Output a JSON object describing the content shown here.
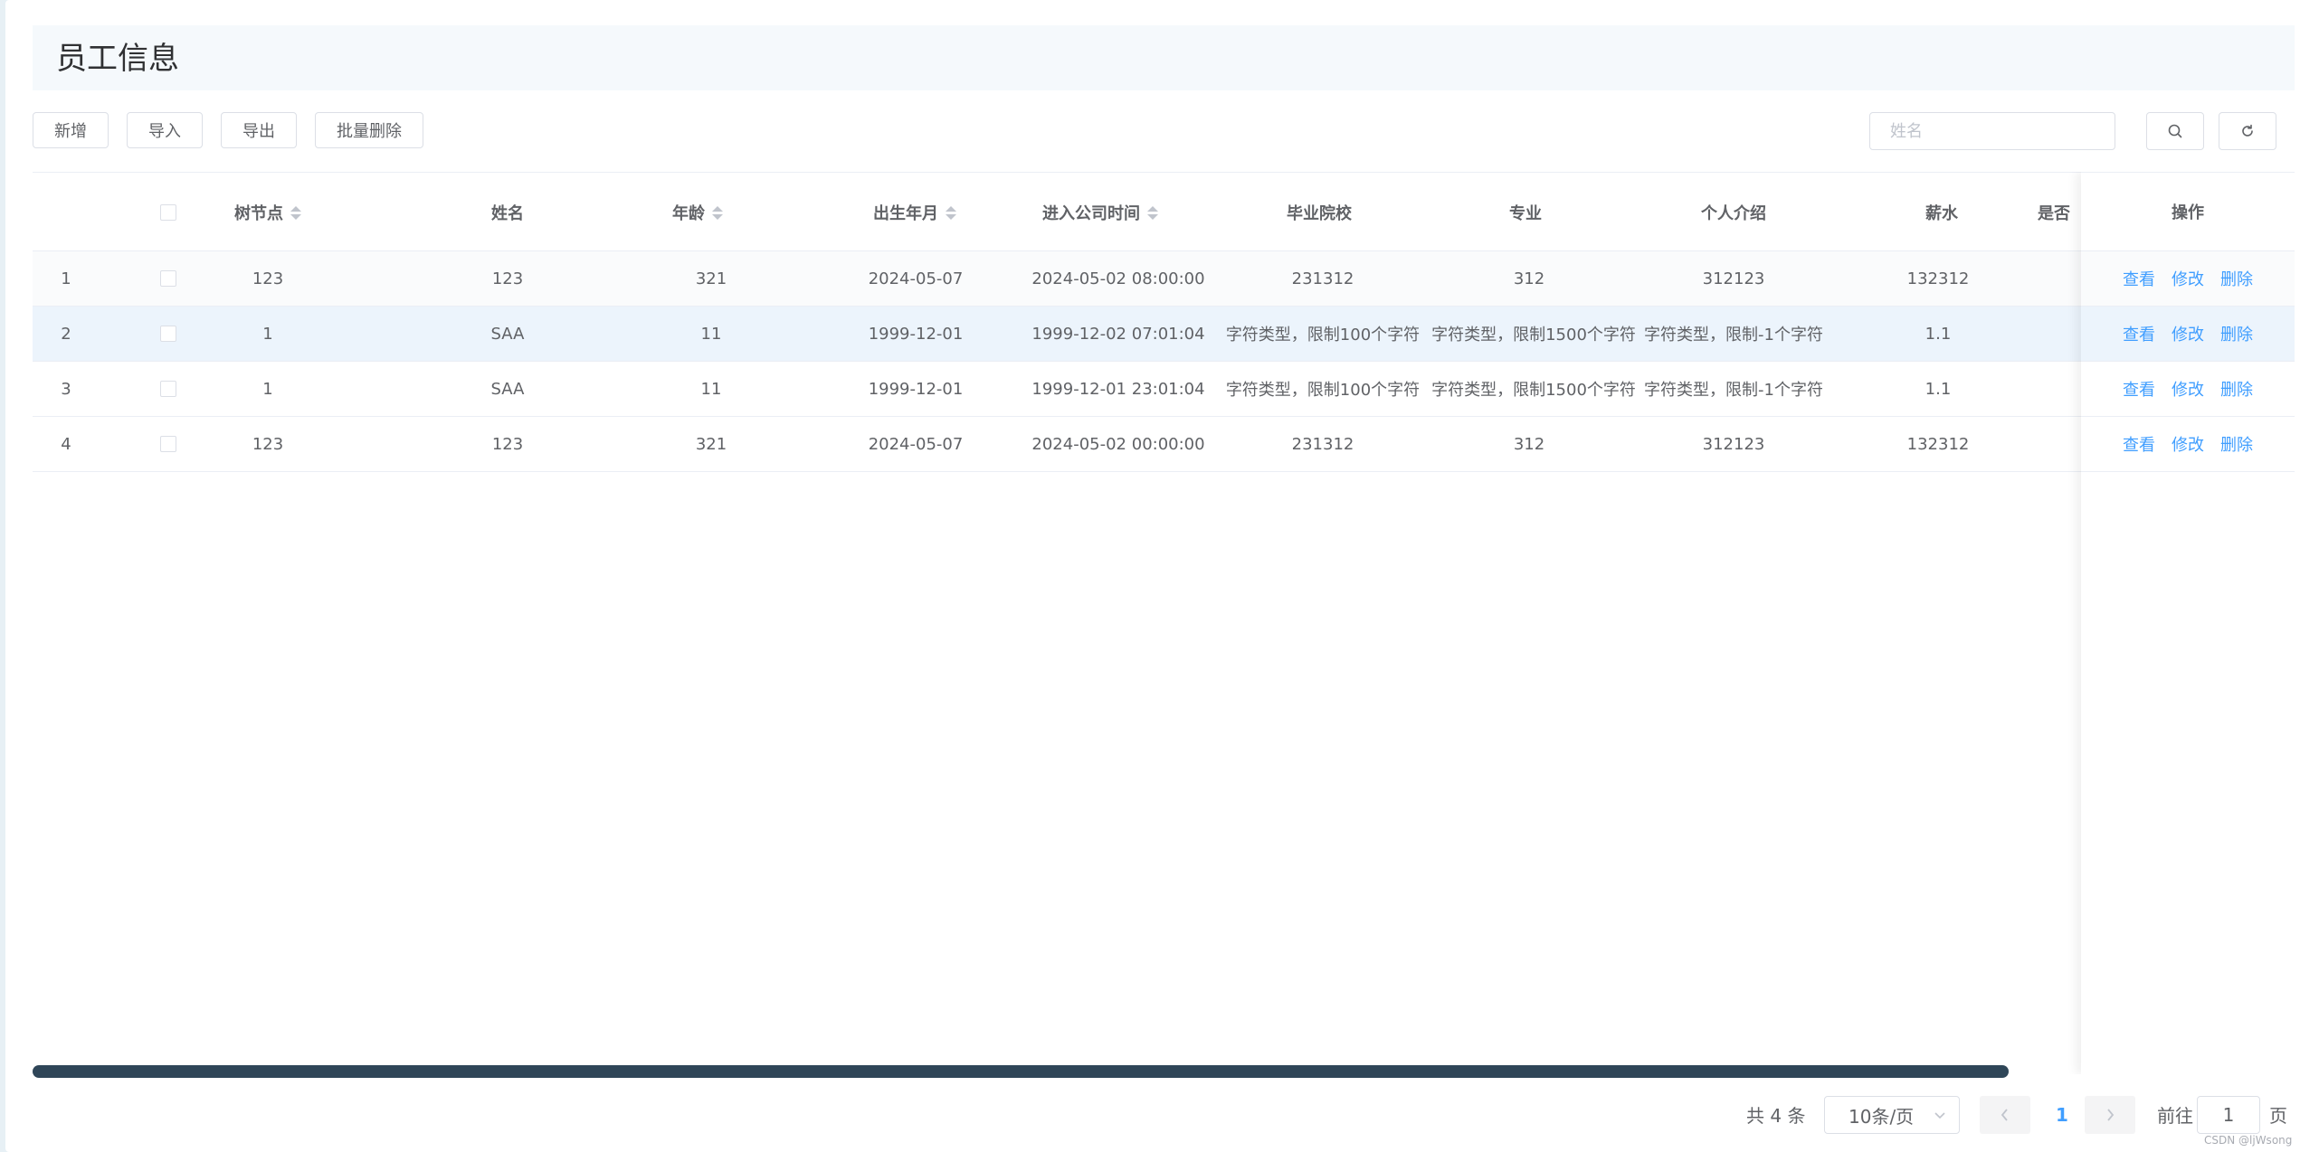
{
  "page": {
    "title": "员工信息"
  },
  "toolbar": {
    "add_label": "新增",
    "import_label": "导入",
    "export_label": "导出",
    "batch_delete_label": "批量删除",
    "search_placeholder": "姓名"
  },
  "table": {
    "headers": {
      "tree_node": "树节点",
      "name": "姓名",
      "age": "年龄",
      "birth": "出生年月",
      "join_time": "进入公司时间",
      "school": "毕业院校",
      "major": "专业",
      "intro": "个人介绍",
      "salary": "薪水",
      "is": "是否",
      "actions": "操作"
    },
    "rows": [
      {
        "index": "1",
        "tree_node": "123",
        "name": "123",
        "age": "321",
        "birth": "2024-05-07",
        "join_time": "2024-05-02 08:00:00",
        "school": "231312",
        "major": "312",
        "intro": "312123",
        "salary": "132312"
      },
      {
        "index": "2",
        "tree_node": "1",
        "name": "SAA",
        "age": "11",
        "birth": "1999-12-01",
        "join_time": "1999-12-02 07:01:04",
        "school": "字符类型，限制100个字符",
        "major": "字符类型，限制1500个字符",
        "intro": "字符类型，限制-1个字符",
        "salary": "1.1"
      },
      {
        "index": "3",
        "tree_node": "1",
        "name": "SAA",
        "age": "11",
        "birth": "1999-12-01",
        "join_time": "1999-12-01 23:01:04",
        "school": "字符类型，限制100个字符",
        "major": "字符类型，限制1500个字符",
        "intro": "字符类型，限制-1个字符",
        "salary": "1.1"
      },
      {
        "index": "4",
        "tree_node": "123",
        "name": "123",
        "age": "321",
        "birth": "2024-05-07",
        "join_time": "2024-05-02 00:00:00",
        "school": "231312",
        "major": "312",
        "intro": "312123",
        "salary": "132312"
      }
    ],
    "action_labels": {
      "view": "查看",
      "edit": "修改",
      "delete": "删除"
    }
  },
  "pagination": {
    "total_text": "共 4 条",
    "page_size": "10条/页",
    "current_page": "1",
    "goto_prefix": "前往",
    "goto_value": "1",
    "goto_suffix": "页"
  },
  "watermark": "CSDN @ljWsong",
  "colors": {
    "link": "#409eff",
    "scrollbar": "#2f4658",
    "header_bg": "#f5f9fc",
    "row_hover": "#ecf4fc"
  }
}
